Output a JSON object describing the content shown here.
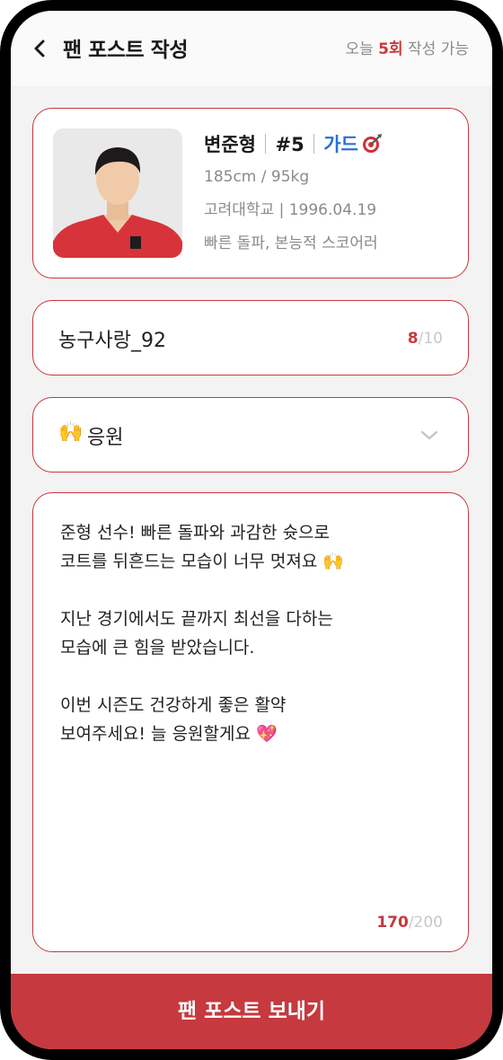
{
  "header": {
    "title": "팬 포스트 작성",
    "quota_prefix": "오늘 ",
    "quota_count": "5회",
    "quota_suffix": " 작성 가능"
  },
  "player": {
    "name": "변준형",
    "number": "#5",
    "position": "가드",
    "position_icon": "target-icon",
    "body": "185cm / 95kg",
    "school_birth": "고려대학교 | 1996.04.19",
    "traits": "빠른 돌파, 본능적 스코어러"
  },
  "nickname": {
    "value": "농구사랑_92",
    "count": "8",
    "max": "/10"
  },
  "category": {
    "emoji": "🙌",
    "label": "응원",
    "icon": "chevron-down-icon"
  },
  "message": {
    "text": "준형 선수! 빠른 돌파와 과감한 슛으로\n코트를 뒤흔드는 모습이 너무 멋져요 🙌\n\n지난 경기에서도 끝까지 최선을 다하는\n모습에 큰 힘을 받았습니다.\n\n이번 시즌도 건강하게 좋은 활약\n보여주세요! 늘 응원할게요 💖",
    "count": "170",
    "max": "/200"
  },
  "submit": {
    "label": "팬 포스트 보내기"
  },
  "colors": {
    "accent": "#c8373e",
    "position": "#2a6fd6",
    "button": "#c5393f"
  }
}
